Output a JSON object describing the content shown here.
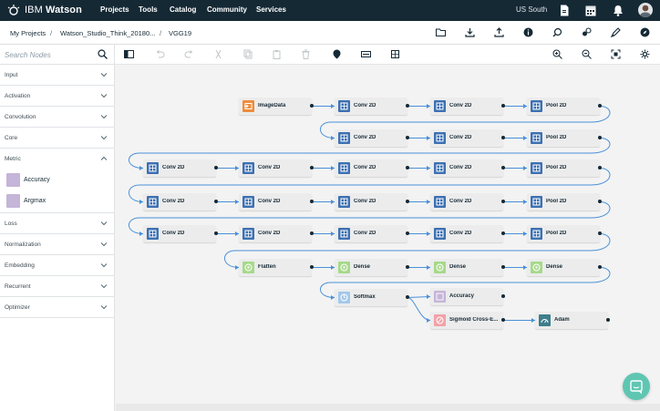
{
  "topnav": {
    "brand_prefix": "IBM",
    "brand_name": "Watson",
    "items": [
      "Projects",
      "Tools",
      "Catalog",
      "Community",
      "Services"
    ],
    "region": "US South"
  },
  "breadcrumb": {
    "items": [
      "My Projects",
      "Watson_Studio_Think_20180...",
      "VGG19"
    ],
    "separator": "/"
  },
  "sidebar": {
    "search_placeholder": "Search Nodes",
    "categories": [
      {
        "label": "Input",
        "expanded": false
      },
      {
        "label": "Activation",
        "expanded": false
      },
      {
        "label": "Convolution",
        "expanded": false
      },
      {
        "label": "Core",
        "expanded": false
      },
      {
        "label": "Metric",
        "expanded": true
      },
      {
        "label": "Loss",
        "expanded": false
      },
      {
        "label": "Normalization",
        "expanded": false
      },
      {
        "label": "Embedding",
        "expanded": false
      },
      {
        "label": "Recurrent",
        "expanded": false
      },
      {
        "label": "Optimizer",
        "expanded": false
      }
    ],
    "metric_items": [
      "Accuracy",
      "Argmax"
    ]
  },
  "nodes": [
    {
      "label": "ImageData",
      "type": "input"
    },
    {
      "label": "Conv 2D",
      "type": "conv"
    },
    {
      "label": "Conv 2D",
      "type": "conv"
    },
    {
      "label": "Pool 2D",
      "type": "conv"
    },
    {
      "label": "Conv 2D",
      "type": "conv"
    },
    {
      "label": "Conv 2D",
      "type": "conv"
    },
    {
      "label": "Pool 2D",
      "type": "conv"
    },
    {
      "label": "Conv 2D",
      "type": "conv"
    },
    {
      "label": "Conv 2D",
      "type": "conv"
    },
    {
      "label": "Conv 2D",
      "type": "conv"
    },
    {
      "label": "Conv 2D",
      "type": "conv"
    },
    {
      "label": "Pool 2D",
      "type": "conv"
    },
    {
      "label": "Conv 2D",
      "type": "conv"
    },
    {
      "label": "Conv 2D",
      "type": "conv"
    },
    {
      "label": "Conv 2D",
      "type": "conv"
    },
    {
      "label": "Conv 2D",
      "type": "conv"
    },
    {
      "label": "Pool 2D",
      "type": "conv"
    },
    {
      "label": "Conv 2D",
      "type": "conv"
    },
    {
      "label": "Conv 2D",
      "type": "conv"
    },
    {
      "label": "Conv 2D",
      "type": "conv"
    },
    {
      "label": "Conv 2D",
      "type": "conv"
    },
    {
      "label": "Pool 2D",
      "type": "conv"
    },
    {
      "label": "Flatten",
      "type": "core"
    },
    {
      "label": "Dense",
      "type": "core"
    },
    {
      "label": "Dense",
      "type": "core"
    },
    {
      "label": "Dense",
      "type": "core"
    },
    {
      "label": "Softmax",
      "type": "activation"
    },
    {
      "label": "Accuracy",
      "type": "metric"
    },
    {
      "label": "Sigmoid Cross-E...",
      "type": "loss"
    },
    {
      "label": "Adam",
      "type": "optimizer"
    }
  ],
  "colors": {
    "topnav_bg": "#152935",
    "input": "#f08c3c",
    "conv": "#3d70b2",
    "core": "#a6d98a",
    "activation": "#a3c8ea",
    "metric": "#c5b5d8",
    "loss": "#f2a1a8",
    "optimizer": "#3f7e8a",
    "wire": "#4a90d9",
    "help": "#5fc6b2"
  }
}
